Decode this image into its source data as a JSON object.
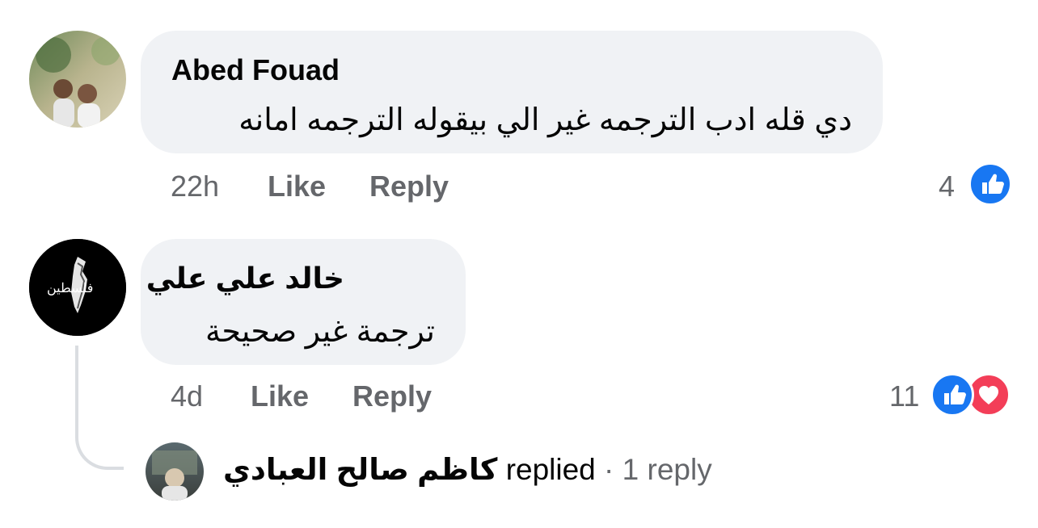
{
  "comments": [
    {
      "author": "Abed Fouad",
      "text": "دي قله ادب الترجمه غير الي بيقوله الترجمه امانه",
      "time": "22h",
      "like_label": "Like",
      "reply_label": "Reply",
      "reaction_count": "4",
      "reactions": [
        "like-icon"
      ]
    },
    {
      "author": "خالد علي علي",
      "text": "ترجمة غير صحيحة",
      "time": "4d",
      "like_label": "Like",
      "reply_label": "Reply",
      "reaction_count": "11",
      "reactions": [
        "like-icon",
        "love-icon"
      ]
    }
  ],
  "reply_summary": {
    "name": "كاظم صالح العبادي",
    "action": "replied",
    "separator": "·",
    "count": "1 reply"
  },
  "colors": {
    "bubble": "#f0f2f5",
    "meta_text": "#65676b",
    "like_blue": "#1877f2",
    "love_red": "#f33e58"
  }
}
